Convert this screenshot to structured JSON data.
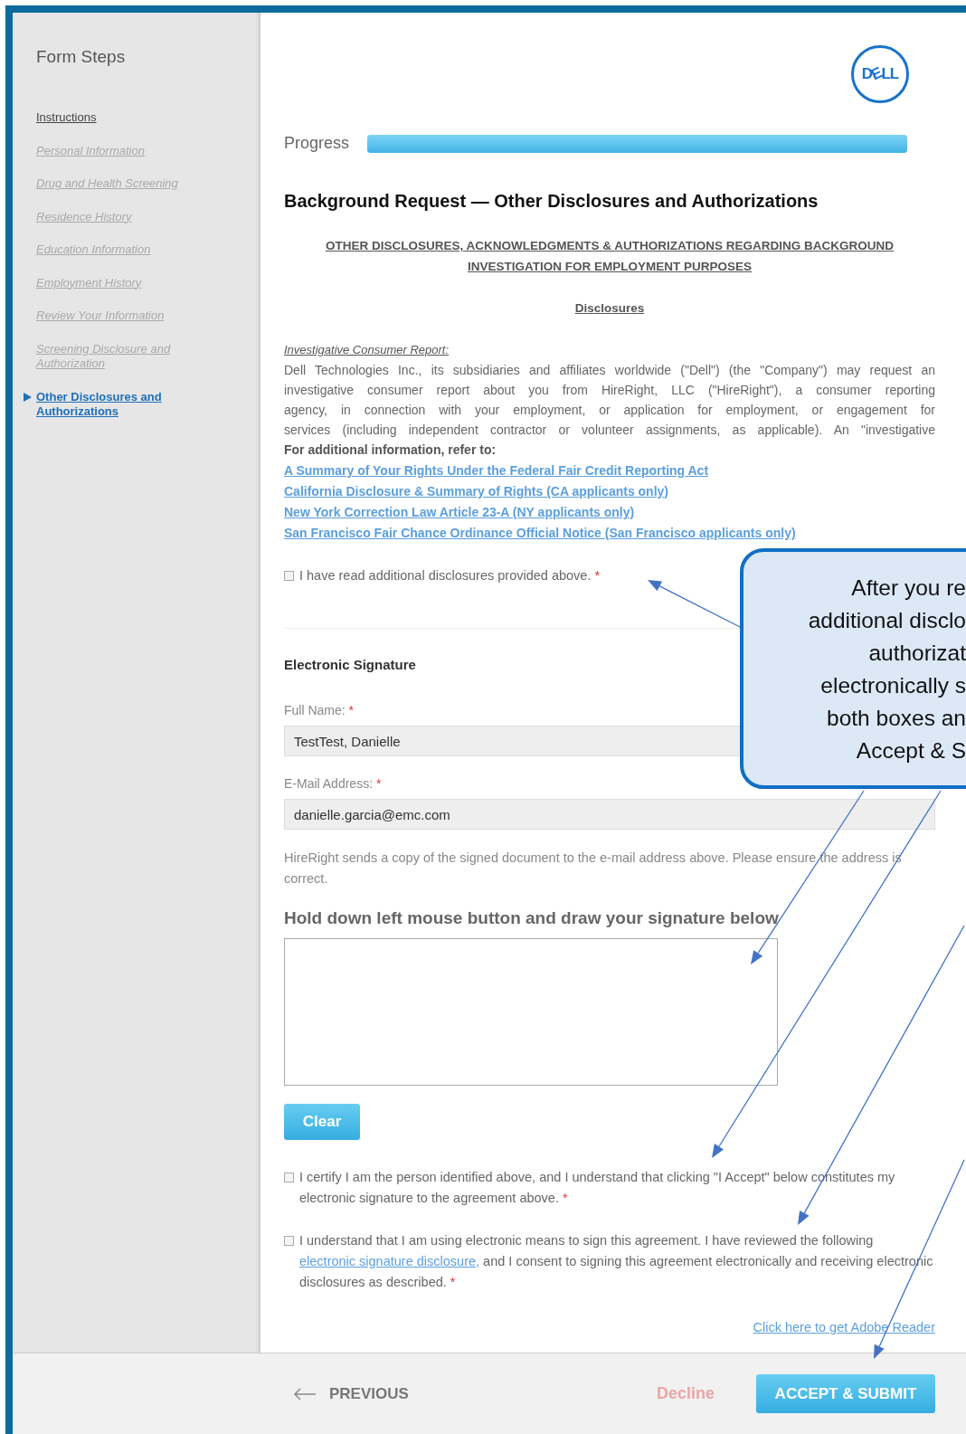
{
  "sidebar": {
    "title": "Form Steps",
    "items": [
      {
        "label": "Instructions",
        "selected": false,
        "disabled": false
      },
      {
        "label": "Personal Information",
        "selected": false,
        "disabled": true
      },
      {
        "label": "Drug and Health Screening",
        "selected": false,
        "disabled": true
      },
      {
        "label": "Residence History",
        "selected": false,
        "disabled": true
      },
      {
        "label": "Education Information",
        "selected": false,
        "disabled": true
      },
      {
        "label": "Employment History",
        "selected": false,
        "disabled": true
      },
      {
        "label": "Review Your Information",
        "selected": false,
        "disabled": true
      },
      {
        "label": "Screening Disclosure and Authorization",
        "selected": false,
        "disabled": true
      },
      {
        "label": "Other Disclosures and Authorizations",
        "selected": true,
        "disabled": false
      }
    ]
  },
  "header": {
    "logo": "DELL",
    "progress": {
      "label": "Progress",
      "level": 1.0
    }
  },
  "title": "Background Request — Other Disclosures and Authorizations",
  "document": {
    "heading": "OTHER DISCLOSURES, ACKNOWLEDGMENTS & AUTHORIZATIONS REGARDING BACKGROUND INVESTIGATION FOR EMPLOYMENT PURPOSES",
    "subheading": "Disclosures",
    "section_label": "Investigative Consumer Report:",
    "paragraph_lines": [
      "Dell Technologies Inc., its subsidiaries and affiliates worldwide (\"Dell\") (the \"Company\") may request an",
      "investigative consumer report about you from HireRight, LLC (\"HireRight\"), a consumer reporting",
      "agency, in connection with your employment, or application for employment, or engagement for",
      "services (including independent contractor or volunteer assignments, as applicable). An \"investigative"
    ]
  },
  "references": {
    "intro": "For additional information, refer to:",
    "links": [
      "A Summary of Your Rights Under the Federal Fair Credit Reporting Act",
      "California Disclosure & Summary of Rights (CA applicants only)",
      "New York Correction Law Article 23-A (NY applicants only)",
      "San Francisco Fair Chance Ordinance Official Notice (San Francisco applicants only)"
    ]
  },
  "read_confirmation": {
    "text": "I have read additional disclosures provided above.",
    "required_mark": "*",
    "checked": false
  },
  "signature": {
    "title": "Electronic Signature",
    "fields": [
      {
        "label": "Full Name:",
        "required_mark": "*",
        "value": "TestTest, Danielle"
      },
      {
        "label": "E-Mail Address:",
        "required_mark": "*",
        "value": "danielle.garcia@emc.com"
      }
    ],
    "help": "HireRight sends a copy of the signed document to the e-mail address above. Please ensure the address is correct.",
    "pad_heading": "Hold down left mouse button and draw your signature below",
    "clear": "Clear",
    "agreements": [
      {
        "text": "I certify I am the person identified above, and I understand that clicking \"I Accept\" below constitutes my electronic signature to the agreement above.",
        "required_mark": "*",
        "checked": false
      },
      {
        "text": "I understand that I am using electronic means to sign this agreement. I have reviewed the following",
        "link": "electronic signature disclosure,",
        "text_after": "and I consent to signing this agreement electronically and receiving electronic disclosures as described.",
        "required_mark": "*",
        "checked": false
      }
    ],
    "adobe_link": "Click here to get Adobe Reader"
  },
  "footer": {
    "previous": "PREVIOUS",
    "decline": "Decline",
    "submit": "ACCEPT & SUBMIT"
  },
  "callout": {
    "lines": [
      "After you re",
      "additional disclo",
      "authorizat",
      "electronically s",
      "both boxes an",
      "Accept & S"
    ]
  }
}
